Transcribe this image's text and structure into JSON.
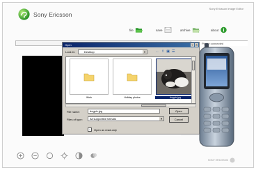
{
  "app": {
    "title": "Sony Ericsson Image Editor",
    "brand": "Sony Ericsson",
    "brand_small": "SONY ERICSSON"
  },
  "toolbar": {
    "file_label": "file",
    "save_label": "save",
    "archive_label": "archive",
    "about_label": "about"
  },
  "status": {
    "connection": "Phone connected"
  },
  "dialog": {
    "title": "Open",
    "lookin_label": "Look in:",
    "lookin_value": "Desktop",
    "files": [
      {
        "name": "Work",
        "kind": "folder"
      },
      {
        "name": "Holiday photos",
        "kind": "folder"
      },
      {
        "name": "dogpic.jpg",
        "kind": "image",
        "selected": true
      }
    ],
    "filename_label": "File name:",
    "filename_value": "dogpic.jpg",
    "filetype_label": "Files of type:",
    "filetype_value": "All supported formats",
    "readonly_label": "Open as read-only",
    "readonly_checked": true,
    "open_button": "Open",
    "cancel_button": "Cancel"
  },
  "colors": {
    "accent_green": "#39a935",
    "dialog_titlebar": "#0a246a",
    "dialog_face": "#d4d0c8"
  }
}
